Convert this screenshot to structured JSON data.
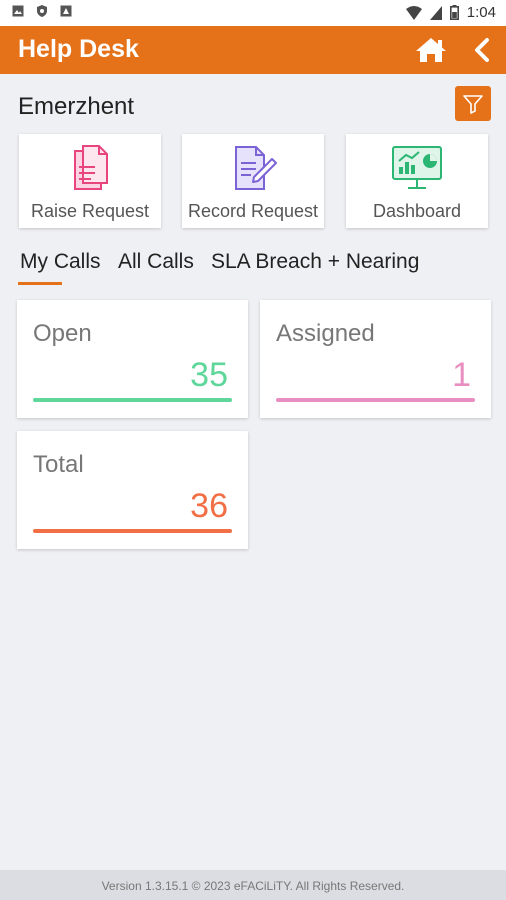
{
  "status_bar": {
    "time": "1:04",
    "left_icons": [
      "gallery-icon",
      "shield-icon",
      "android-icon"
    ],
    "right_icons": [
      "wifi-icon",
      "signal-icon",
      "battery-icon"
    ]
  },
  "app_bar": {
    "title": "Help Desk",
    "color": "#e57119",
    "icons": [
      "home-icon",
      "back-chevron-icon"
    ]
  },
  "company_name": "Emerzhent",
  "filter_icon": "filter-icon",
  "actions": [
    {
      "label": "Raise Request",
      "icon": "raise-request-icon",
      "color": "#e8457f"
    },
    {
      "label": "Record Request",
      "icon": "record-request-icon",
      "color": "#7b63d6"
    },
    {
      "label": "Dashboard",
      "icon": "dashboard-icon",
      "color": "#2bb673"
    }
  ],
  "tabs": [
    {
      "label": "My Calls",
      "active": true
    },
    {
      "label": "All Calls",
      "active": false
    },
    {
      "label": "SLA Breach + Nearing",
      "active": false
    }
  ],
  "stats": [
    {
      "label": "Open",
      "value": "35",
      "color": "#5fd69a",
      "fill": 1.0
    },
    {
      "label": "Assigned",
      "value": "1",
      "color": "#e98ec0",
      "fill": 1.0
    },
    {
      "label": "Total",
      "value": "36",
      "color": "#f26f45",
      "fill": 1.0
    }
  ],
  "footer": {
    "text": "Version 1.3.15.1 © 2023 eFACiLiTY. All Rights Reserved."
  }
}
